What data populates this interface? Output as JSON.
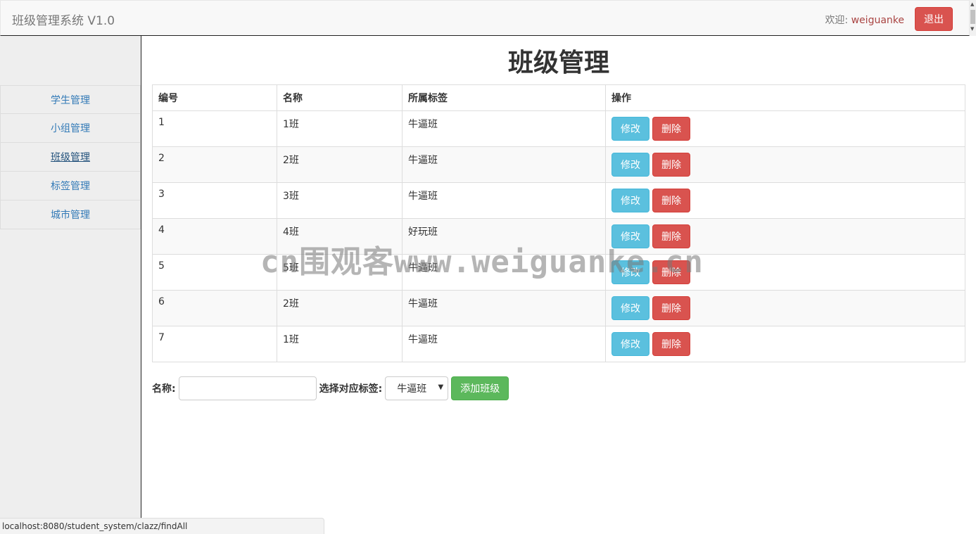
{
  "header": {
    "brand": "班级管理系统 V1.0",
    "welcome_prefix": "欢迎: ",
    "username": "weiguanke",
    "logout_label": "退出"
  },
  "sidebar": {
    "items": [
      {
        "label": "学生管理"
      },
      {
        "label": "小组管理"
      },
      {
        "label": "班级管理"
      },
      {
        "label": "标签管理"
      },
      {
        "label": "城市管理"
      }
    ]
  },
  "main": {
    "title": "班级管理",
    "table": {
      "headers": [
        "编号",
        "名称",
        "所属标签",
        "操作"
      ],
      "rows": [
        {
          "id": "1",
          "name": "1班",
          "tag": "牛逼班"
        },
        {
          "id": "2",
          "name": "2班",
          "tag": "牛逼班"
        },
        {
          "id": "3",
          "name": "3班",
          "tag": "牛逼班"
        },
        {
          "id": "4",
          "name": "4班",
          "tag": "好玩班"
        },
        {
          "id": "5",
          "name": "5班",
          "tag": "牛逼班"
        },
        {
          "id": "6",
          "name": "2班",
          "tag": "牛逼班"
        },
        {
          "id": "7",
          "name": "1班",
          "tag": "牛逼班"
        }
      ],
      "edit_label": "修改",
      "delete_label": "删除"
    },
    "form": {
      "name_label": "名称:",
      "name_value": "",
      "tag_label": "选择对应标签:",
      "tag_selected": "牛逼班",
      "add_label": "添加班级"
    }
  },
  "watermark": "cn围观客www.weiguanke.cn",
  "statusbar": "localhost:8080/student_system/clazz/findAll"
}
